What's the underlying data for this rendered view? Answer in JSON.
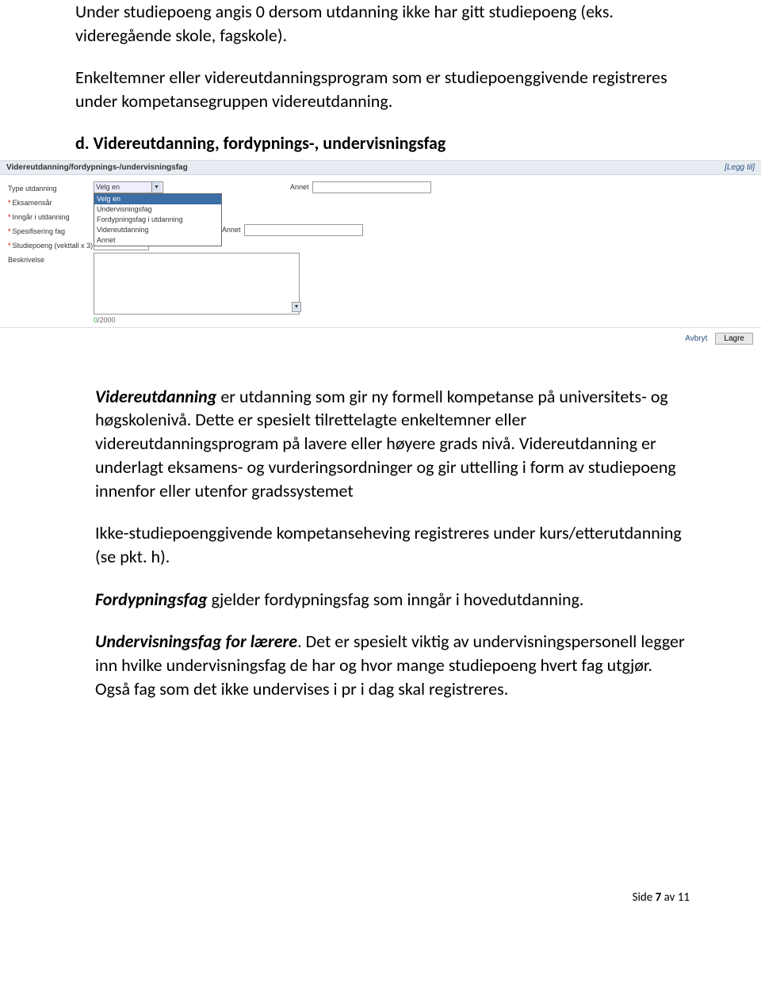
{
  "intro": {
    "p1": "Under studiepoeng angis 0 dersom utdanning ikke har gitt studiepoeng (eks. videregående skole, fagskole).",
    "p2": "Enkeltemner eller videreutdanningsprogram som er studiepoenggivende registreres under kompetansegruppen videreutdanning."
  },
  "heading_d": "d. Videreutdanning, fordypnings-, undervisningsfag",
  "form": {
    "title": "Videreutdanning/fordypnings-/undervisningsfag",
    "legg_til": "[Legg til]",
    "labels": {
      "type": "Type utdanning",
      "eksamensar": "Eksamensår",
      "inngar": "Inngår i utdanning",
      "spesifisering": "Spesifisering fag",
      "studiepoeng": "Studiepoeng (vekttall x 3)",
      "beskrivelse": "Beskrivelse",
      "annet": "Annet"
    },
    "select_placeholder": "Velg en",
    "dropdown_options": [
      "Velg en",
      "Undervisningsfag",
      "Fordypningsfag i utdanning",
      "Videreutdanning",
      "Annet"
    ],
    "char_count_zero": "0",
    "char_count_max": "/2000",
    "footer_avbryt": "Avbryt",
    "footer_lagre": "Lagre"
  },
  "body": {
    "p3_lead": "Videreutdanning",
    "p3_rest": " er utdanning som gir ny formell kompetanse på universitets- og høgskolenivå. Dette er spesielt tilrettelagte enkeltemner eller videreutdanningsprogram på lavere eller høyere grads nivå. Videreutdanning er underlagt eksamens- og vurderingsordninger og gir uttelling i form av studiepoeng innenfor eller utenfor gradssystemet",
    "p4": "Ikke-studiepoenggivende kompetanseheving registreres under kurs/etterutdanning (se pkt. h).",
    "p5_lead": "Fordypningsfag",
    "p5_rest": " gjelder fordypningsfag som inngår i hovedutdanning.",
    "p6_lead": "Undervisningsfag for lærere",
    "p6_rest": ". Det er spesielt viktig av undervisningspersonell legger inn hvilke undervisningsfag de har og hvor mange studiepoeng hvert fag utgjør. Også fag som det ikke undervises i pr i dag skal registreres."
  },
  "footer": {
    "side": "Side ",
    "page": "7",
    "av": " av ",
    "total": "11"
  }
}
